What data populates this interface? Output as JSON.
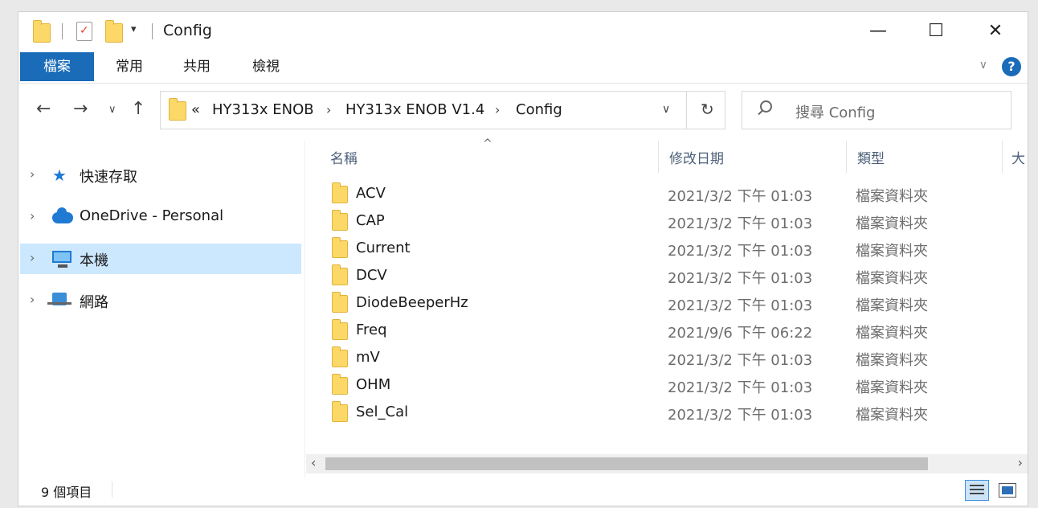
{
  "window": {
    "title": "Config"
  },
  "window_controls": {
    "minimize": "—",
    "maximize": "☐",
    "close": "✕"
  },
  "ribbon": {
    "tabs": [
      {
        "label": "檔案",
        "active": true
      },
      {
        "label": "常用"
      },
      {
        "label": "共用"
      },
      {
        "label": "檢視"
      }
    ],
    "help": "?"
  },
  "nav": {
    "breadcrumb": [
      "«",
      "HY313x ENOB",
      "HY313x ENOB V1.4",
      "Config"
    ],
    "search_placeholder": "搜尋 Config"
  },
  "sidebar": {
    "items": [
      {
        "label": "快速存取",
        "icon": "star-icon"
      },
      {
        "label": "OneDrive - Personal",
        "icon": "cloud-icon"
      },
      {
        "label": "本機",
        "icon": "computer-icon",
        "selected": true
      },
      {
        "label": "網路",
        "icon": "network-icon"
      }
    ]
  },
  "list": {
    "columns": [
      "名稱",
      "修改日期",
      "類型",
      "大"
    ],
    "rows": [
      {
        "name": "ACV",
        "date": "2021/3/2 下午 01:03",
        "type": "檔案資料夾"
      },
      {
        "name": "CAP",
        "date": "2021/3/2 下午 01:03",
        "type": "檔案資料夾"
      },
      {
        "name": "Current",
        "date": "2021/3/2 下午 01:03",
        "type": "檔案資料夾"
      },
      {
        "name": "DCV",
        "date": "2021/3/2 下午 01:03",
        "type": "檔案資料夾"
      },
      {
        "name": "DiodeBeeperHz",
        "date": "2021/3/2 下午 01:03",
        "type": "檔案資料夾"
      },
      {
        "name": "Freq",
        "date": "2021/9/6 下午 06:22",
        "type": "檔案資料夾"
      },
      {
        "name": "mV",
        "date": "2021/3/2 下午 01:03",
        "type": "檔案資料夾"
      },
      {
        "name": "OHM",
        "date": "2021/3/2 下午 01:03",
        "type": "檔案資料夾"
      },
      {
        "name": "Sel_Cal",
        "date": "2021/3/2 下午 01:03",
        "type": "檔案資料夾"
      }
    ]
  },
  "status": {
    "count": "9 個項目"
  },
  "colors": {
    "accent": "#1a6bb8",
    "selection": "#cce8ff",
    "folder": "#fcd868"
  }
}
